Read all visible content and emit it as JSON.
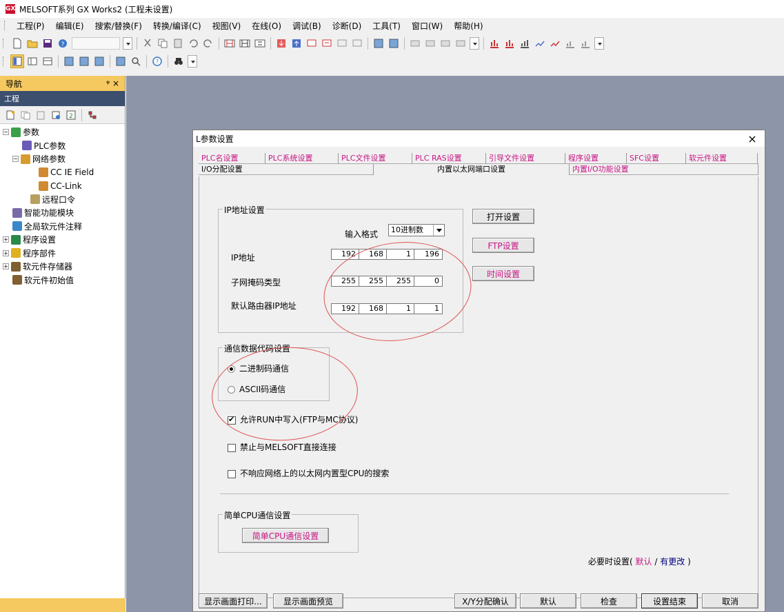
{
  "window": {
    "title": "MELSOFT系列 GX Works2 (工程未设置)",
    "icon_text": "GX"
  },
  "menu": [
    "工程(P)",
    "编辑(E)",
    "搜索/替换(F)",
    "转换/编译(C)",
    "视图(V)",
    "在线(O)",
    "调试(B)",
    "诊断(D)",
    "工具(T)",
    "窗口(W)",
    "帮助(H)"
  ],
  "nav": {
    "header": "导航",
    "pin_close": "ᵠ ×",
    "subheader": "工程",
    "tree": [
      {
        "label": "参数",
        "exp": "−"
      },
      {
        "label": "PLC参数",
        "exp": ""
      },
      {
        "label": "网络参数",
        "exp": "−"
      },
      {
        "label": "CC IE Field",
        "exp": ""
      },
      {
        "label": "CC-Link",
        "exp": ""
      },
      {
        "label": "远程口令",
        "exp": ""
      },
      {
        "label": "智能功能模块",
        "exp": ""
      },
      {
        "label": "全局软元件注释",
        "exp": ""
      },
      {
        "label": "程序设置",
        "exp": "+"
      },
      {
        "label": "程序部件",
        "exp": "+"
      },
      {
        "label": "软元件存储器",
        "exp": "+"
      },
      {
        "label": "软元件初始值",
        "exp": ""
      }
    ]
  },
  "dialog": {
    "title": "L参数设置",
    "close": "×",
    "tabs_row1": [
      "PLC名设置",
      "PLC系统设置",
      "PLC文件设置",
      "PLC RAS设置",
      "引导文件设置",
      "程序设置",
      "SFC设置",
      "软元件设置"
    ],
    "tabs_row2": [
      "I/O分配设置",
      "内置以太网端口设置",
      "内置I/O功能设置"
    ],
    "ip_group": {
      "title": "IP地址设置",
      "input_format_label": "输入格式",
      "input_format_value": "10进制数",
      "ip_label": "IP地址",
      "ip": [
        "192",
        "168",
        "1",
        "196"
      ],
      "subnet_label": "子网掩码类型",
      "subnet": [
        "255",
        "255",
        "255",
        "0"
      ],
      "gateway_label": "默认路由器IP地址",
      "gateway": [
        "192",
        "168",
        "1",
        "1"
      ]
    },
    "buttons_right": {
      "open": "打开设置",
      "ftp": "FTP设置",
      "time": "时间设置"
    },
    "comm_group": {
      "title": "通信数据代码设置",
      "binary": "二进制码通信",
      "ascii": "ASCII码通信"
    },
    "checks": {
      "allow_run_write": "允许RUN中写入(FTP与MC协议)",
      "forbid_direct": "禁止与MELSOFT直接连接",
      "no_search_response": "不响应网络上的以太网内置型CPU的搜索"
    },
    "simple_cpu": {
      "title": "简单CPU通信设置",
      "button": "简单CPU通信设置"
    },
    "legend": {
      "prefix": "必要时设置(",
      "default": "默认",
      "sep": "/",
      "changed": "有更改",
      "suffix": ")"
    },
    "bottom_buttons": {
      "print": "显示画面打印...",
      "preview": "显示画面预览",
      "xy": "X/Y分配确认",
      "default": "默认",
      "check": "检查",
      "finish": "设置结束",
      "cancel": "取消"
    }
  },
  "colors": {
    "accent_tab": "#c71585",
    "nav_header": "#f5c95f",
    "workspace": "#8d96a8",
    "annotation": "#e05050"
  }
}
